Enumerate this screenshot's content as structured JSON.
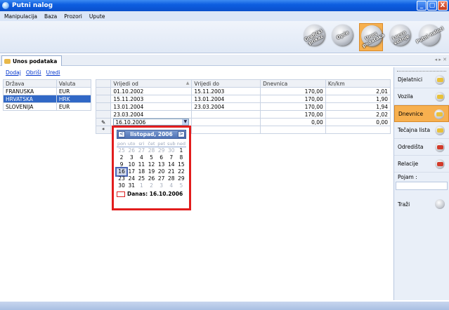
{
  "window": {
    "title": "Putni nalog",
    "btn_min": "_",
    "btn_max": "▢",
    "btn_close": "X"
  },
  "menu": [
    "Manipulacija",
    "Baza",
    "Prozori",
    "Upute"
  ],
  "toolbar": [
    {
      "label": "Grafički prikaz",
      "active": false
    },
    {
      "label": "Opće",
      "active": false
    },
    {
      "label": "Unos podataka",
      "active": true
    },
    {
      "label": "Locco vožnje",
      "active": false
    },
    {
      "label": "Putni nalozi",
      "active": false
    }
  ],
  "tab": {
    "label": "Unos podataka",
    "controls": "◂ ▸ ✕"
  },
  "actions": {
    "add": "Dodaj",
    "delete": "Obriši",
    "edit": "Uredi"
  },
  "left_table": {
    "headers": [
      "Država",
      "Valuta"
    ],
    "rows": [
      {
        "country": "FRANUSKA",
        "currency": "EUR"
      },
      {
        "country": "HRVATSKA",
        "currency": "HRK"
      },
      {
        "country": "SLOVENIJA",
        "currency": "EUR"
      }
    ]
  },
  "right_table": {
    "headers": [
      "Vrijedi od",
      "Vrijedi do",
      "Dnevnica",
      "Kn/km"
    ],
    "sort_icon": "▲",
    "rows": [
      {
        "from": "01.10.2002",
        "to": "15.11.2003",
        "daily": "170,00",
        "km": "2,01"
      },
      {
        "from": "15.11.2003",
        "to": "13.01.2004",
        "daily": "170,00",
        "km": "1,90"
      },
      {
        "from": "13.01.2004",
        "to": "23.03.2004",
        "daily": "170,00",
        "km": "1,94"
      },
      {
        "from": "23.03.2004",
        "to": "",
        "daily": "170,00",
        "km": "2,02"
      }
    ],
    "edit_row": {
      "indicator": "✎",
      "date": "16.10.2006",
      "daily": "0,00",
      "km": "0,00"
    },
    "new_row": {
      "indicator": "*"
    }
  },
  "calendar": {
    "prev": "<",
    "next": ">",
    "month": "listopad, 2006",
    "dow": [
      "pon",
      "uto",
      "sri",
      "čet",
      "pet",
      "sub",
      "ned"
    ],
    "today_label": "Danas: 16.10.2006"
  },
  "sidebar": {
    "items": [
      "Djelatnici",
      "Vozila",
      "Dnevnice",
      "Tečajna lista",
      "Odredišta",
      "Relacije"
    ],
    "active_index": 2,
    "search_label": "Pojam :",
    "search_button": "Traži"
  }
}
